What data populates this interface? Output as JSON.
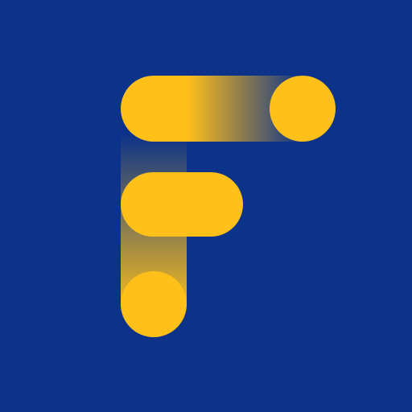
{
  "logo": {
    "name": "F",
    "colors": {
      "background": "#0C3389",
      "accent": "#FFC01A"
    }
  }
}
